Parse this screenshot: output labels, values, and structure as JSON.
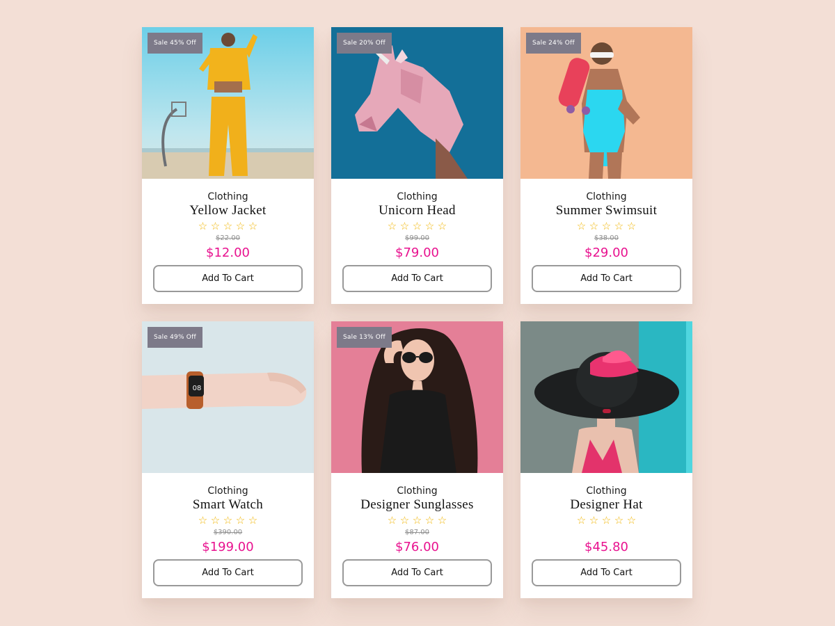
{
  "products": [
    {
      "badge": "Sale 45% Off",
      "category": "Clothing",
      "title": "Yellow Jacket",
      "old_price": "$22.00",
      "price": "$12.00",
      "rating_stars": 5,
      "rating_filled": 0,
      "cta": "Add To Cart"
    },
    {
      "badge": "Sale 20% Off",
      "category": "Clothing",
      "title": "Unicorn Head",
      "old_price": "$99.00",
      "price": "$79.00",
      "rating_stars": 5,
      "rating_filled": 0,
      "cta": "Add To Cart"
    },
    {
      "badge": "Sale 24% Off",
      "category": "Clothing",
      "title": "Summer Swimsuit",
      "old_price": "$38.00",
      "price": "$29.00",
      "rating_stars": 5,
      "rating_filled": 0,
      "cta": "Add To Cart"
    },
    {
      "badge": "Sale 49% Off",
      "category": "Clothing",
      "title": "Smart Watch",
      "old_price": "$390.00",
      "price": "$199.00",
      "rating_stars": 5,
      "rating_filled": 0,
      "cta": "Add To Cart",
      "watch_display": "08"
    },
    {
      "badge": "Sale 13% Off",
      "category": "Clothing",
      "title": "Designer Sunglasses",
      "old_price": "$87.00",
      "price": "$76.00",
      "rating_stars": 5,
      "rating_filled": 0,
      "cta": "Add To Cart"
    },
    {
      "badge": "",
      "category": "Clothing",
      "title": "Designer Hat",
      "old_price": "",
      "price": "$45.80",
      "rating_stars": 5,
      "rating_filled": 0,
      "cta": "Add To Cart"
    }
  ],
  "colors": {
    "page_background": "#f3dfd6",
    "card_background": "#ffffff",
    "badge_background": "#7d7a89",
    "price": "#e8128f",
    "star": "#f0b400",
    "button_border": "#999999"
  },
  "icons": {
    "rating": "star-outline-icon"
  }
}
